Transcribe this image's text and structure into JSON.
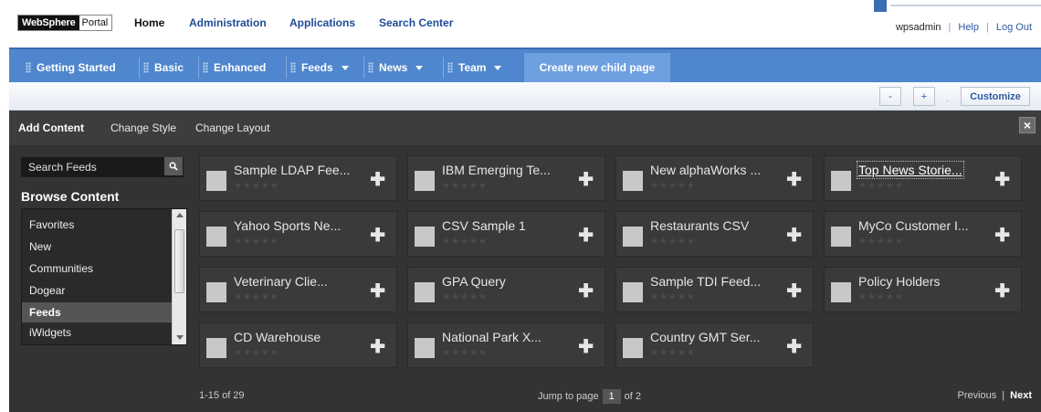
{
  "brand": {
    "part1": "WebSphere",
    "part2": "Portal"
  },
  "topnav": {
    "home": "Home",
    "administration": "Administration",
    "applications": "Applications",
    "search_center": "Search Center"
  },
  "userbar": {
    "user": "wpsadmin",
    "sep": "|",
    "help": "Help",
    "logout": "Log Out"
  },
  "pagetabs": {
    "getting_started": "Getting Started",
    "basic": "Basic",
    "enhanced": "Enhanced",
    "feeds": "Feeds",
    "news": "News",
    "team": "Team",
    "create_child": "Create new child page"
  },
  "toolbar": {
    "minus": "-",
    "plus": "+",
    "dot": ".",
    "customize": "Customize"
  },
  "panel": {
    "tabs": {
      "add_content": "Add Content",
      "change_style": "Change Style",
      "change_layout": "Change Layout"
    },
    "close": "×",
    "search_placeholder": "Search Feeds",
    "browse_title": "Browse Content",
    "browse_items": [
      "Favorites",
      "New",
      "Communities",
      "Dogear",
      "Feeds",
      "iWidgets"
    ],
    "selected_item": "Feeds",
    "cards": [
      "Sample LDAP Fee...",
      "IBM Emerging Te...",
      "New alphaWorks ...",
      "Top News Storie...",
      "Yahoo Sports Ne...",
      "CSV Sample 1",
      "Restaurants CSV",
      "MyCo Customer I...",
      "Veterinary Clie...",
      "GPA Query",
      "Sample TDI Feed...",
      "Policy Holders",
      "CD Warehouse",
      "National Park X...",
      "Country GMT Ser..."
    ],
    "stars": "★★★★★",
    "add_symbol": "✚",
    "footer": {
      "range": "1-15 of 29",
      "jump_label": "Jump to page",
      "page": "1",
      "of_pages": "of 2",
      "previous": "Previous",
      "sep": "|",
      "next": "Next"
    }
  }
}
